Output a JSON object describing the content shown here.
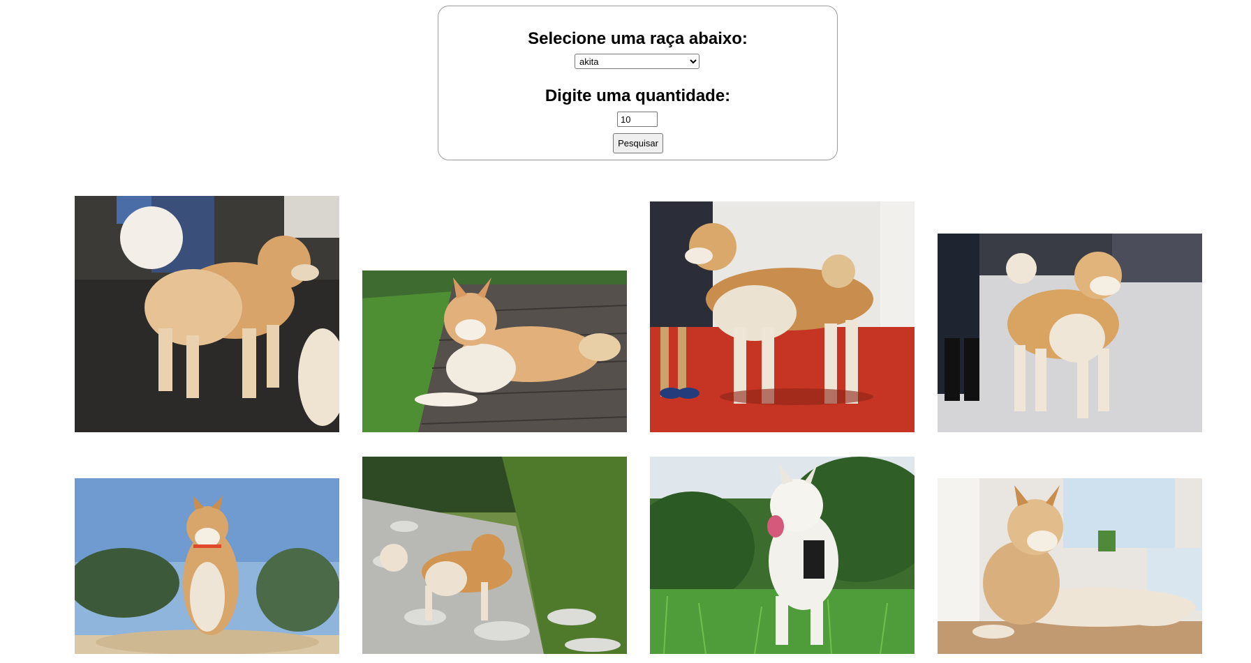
{
  "form": {
    "breed_heading": "Selecione uma raça abaixo:",
    "breed_selected": "akita",
    "quantity_heading": "Digite uma quantidade:",
    "quantity_value": "10",
    "search_label": "Pesquisar"
  },
  "gallery": {
    "images": [
      {
        "name": "dog-photo-1",
        "scene": "dark floor, fluffy spitz-type dog"
      },
      {
        "name": "dog-photo-2",
        "scene": "akita lying on wooden deck"
      },
      {
        "name": "dog-photo-3",
        "scene": "akita on red carpet show ring"
      },
      {
        "name": "dog-photo-4",
        "scene": "akita standing on snow"
      },
      {
        "name": "dog-photo-5",
        "scene": "akita on sand under blue sky"
      },
      {
        "name": "dog-photo-6",
        "scene": "akita on rocky forest trail"
      },
      {
        "name": "dog-photo-7",
        "scene": "white akita in green grass"
      },
      {
        "name": "dog-photo-8",
        "scene": "akita lying indoors"
      }
    ]
  }
}
